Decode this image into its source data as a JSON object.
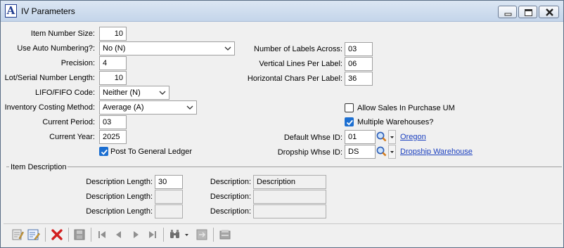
{
  "window": {
    "title": "IV Parameters"
  },
  "form": {
    "item_number_size": {
      "label": "Item Number Size:",
      "value": "10"
    },
    "use_auto_numbering": {
      "label": "Use Auto Numbering?:",
      "value": "No (N)"
    },
    "precision": {
      "label": "Precision:",
      "value": "4"
    },
    "lot_serial_number_length": {
      "label": "Lot/Serial Number Length:",
      "value": "10"
    },
    "lifo_fifo_code": {
      "label": "LIFO/FIFO Code:",
      "value": "Neither (N)"
    },
    "inventory_costing_method": {
      "label": "Inventory Costing Method:",
      "value": "Average (A)"
    },
    "current_period": {
      "label": "Current Period:",
      "value": "03"
    },
    "current_year": {
      "label": "Current Year:",
      "value": "2025"
    },
    "post_to_general_ledger": {
      "label": "Post To General Ledger",
      "checked": true
    },
    "number_of_labels_across": {
      "label": "Number of Labels Across:",
      "value": "03"
    },
    "vertical_lines_per_label": {
      "label": "Vertical Lines Per Label:",
      "value": "06"
    },
    "horizontal_chars_per_label": {
      "label": "Horizontal Chars Per Label:",
      "value": "36"
    },
    "allow_sales_in_purchase_um": {
      "label": "Allow Sales In Purchase UM",
      "checked": false
    },
    "multiple_warehouses": {
      "label": "Multiple Warehouses?",
      "checked": true
    },
    "default_whse_id": {
      "label": "Default Whse ID:",
      "value": "01",
      "link": "Oregon"
    },
    "dropship_whse_id": {
      "label": "Dropship Whse ID:",
      "value": "DS",
      "link": "Dropship Warehouse"
    }
  },
  "item_description": {
    "group_label": "Item Description",
    "rows": [
      {
        "length_label": "Description Length:",
        "length": "30",
        "desc_label": "Description:",
        "desc": "Description"
      },
      {
        "length_label": "Description Length:",
        "length": "",
        "desc_label": "Description:",
        "desc": ""
      },
      {
        "length_label": "Description Length:",
        "length": "",
        "desc_label": "Description:",
        "desc": ""
      }
    ]
  },
  "toolbar": {
    "icons": [
      "notes-icon",
      "edit-form-icon",
      "delete-icon",
      "save-icon",
      "first-record-icon",
      "previous-record-icon",
      "next-record-icon",
      "last-record-icon",
      "find-icon",
      "find-dropdown-icon",
      "export-icon",
      "print-icon"
    ]
  },
  "colors": {
    "checkbox_accent": "#1c6fd1",
    "link": "#1a3fbf",
    "delete": "#d21f1f"
  }
}
